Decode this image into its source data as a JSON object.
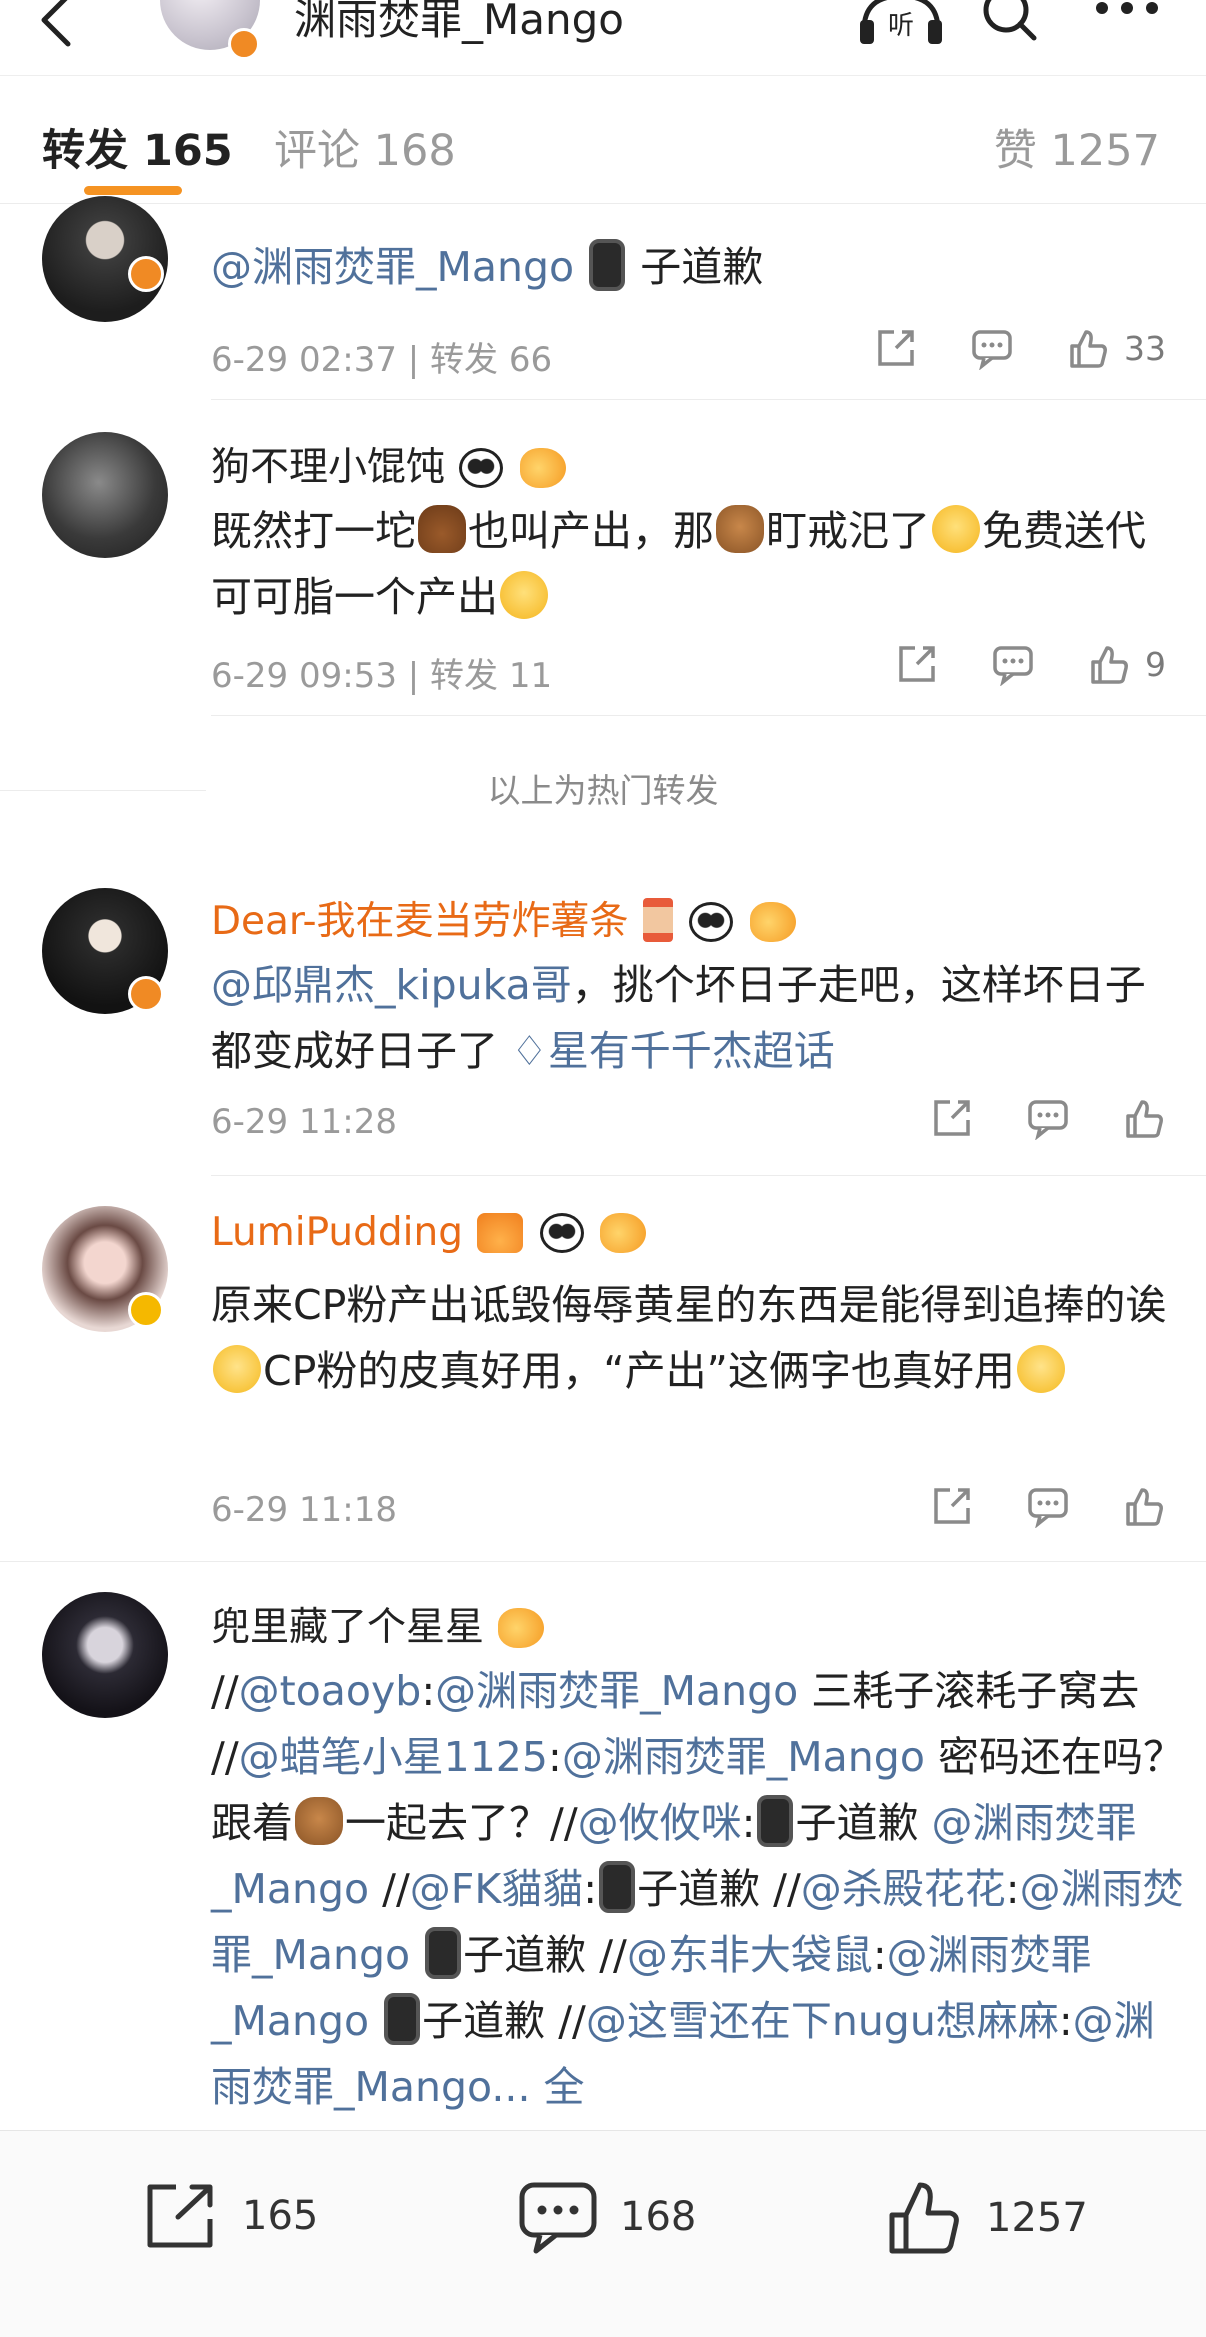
{
  "header": {
    "title": "渊雨焚罪_Mango"
  },
  "tabs": {
    "repost": "转发 165",
    "comment": "评论 168",
    "like": "赞 1257"
  },
  "posts": [
    {
      "name": "",
      "body_mention": "@渊雨焚罪_Mango",
      "body_text": "子道歉",
      "meta": "6-29 02:37 | 转发 66",
      "likes": "33"
    },
    {
      "name": "狗不理小馄饨",
      "body_a": "既然打一坨",
      "body_b": "也叫产出，那",
      "body_c": "盯戒汜了",
      "body_d": "免费送代可可脂一个产出",
      "meta": "6-29 09:53 | 转发 11",
      "likes": "9"
    },
    {
      "name": "Dear-我在麦当劳炸薯条",
      "body_mention": "@邱鼎杰_kipuka哥",
      "body_text": "，挑个坏日子走吧，这样坏日子都变成好日子了",
      "topic": "星有千千杰超话",
      "meta": "6-29 11:28"
    },
    {
      "name": "LumiPudding",
      "body_a": "原来CP粉产出诋毁侮辱黄星的东西是能得到追捧的诶",
      "body_b": "CP粉的皮真好用，“产出”这俩字也真好用",
      "meta": "6-29 11:18"
    },
    {
      "name": "兜里藏了个星星",
      "seg": [
        "//",
        "@toaoyb",
        ":",
        "@渊雨焚罪_Mango",
        " 三耗子滚耗子窝去 //",
        "@蜡笔小星1125",
        ":",
        "@渊雨焚罪_Mango",
        " 密码还在吗？跟着",
        "一起去了？//",
        "@攸攸咪",
        ":",
        "子道歉",
        "@渊雨焚罪_Mango",
        " //",
        "@FK貓貓",
        ":",
        "子道歉 //",
        "@杀殿花花",
        ":",
        "@渊雨焚罪_Mango",
        "子道歉 //",
        "@东非大袋鼠",
        ":",
        "@渊雨焚罪_Mango",
        "子道歉 //",
        "@这雪还在下nugu想麻麻",
        ":",
        "@渊雨焚罪_Mango...",
        " 全"
      ]
    }
  ],
  "hot_label": "以上为热门转发",
  "bottom": {
    "repost": "165",
    "comment": "168",
    "like": "1257"
  }
}
